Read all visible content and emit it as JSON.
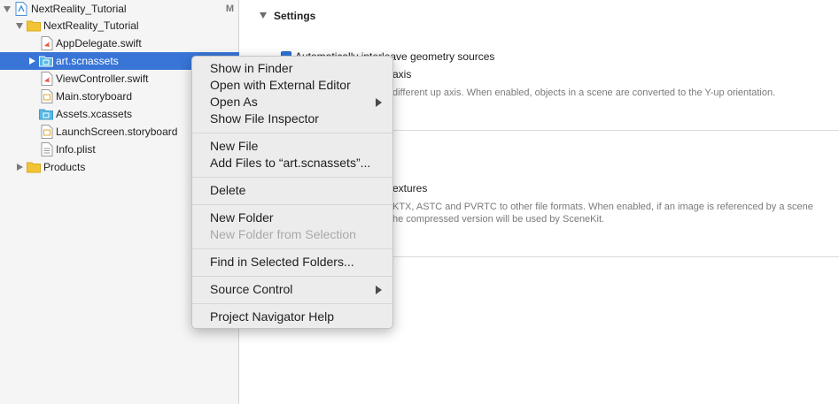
{
  "navigator": {
    "project": {
      "label": "NextReality_Tutorial",
      "badge": "M",
      "icon": "xcode-project-icon"
    },
    "items": [
      {
        "label": "NextReality_Tutorial",
        "icon": "folder-icon",
        "expanded": true
      },
      {
        "label": "AppDelegate.swift",
        "icon": "swift-file-icon"
      },
      {
        "label": "art.scnassets",
        "icon": "scnassets-folder-icon",
        "selected": true
      },
      {
        "label": "ViewController.swift",
        "icon": "swift-file-icon"
      },
      {
        "label": "Main.storyboard",
        "icon": "storyboard-file-icon"
      },
      {
        "label": "Assets.xcassets",
        "icon": "xcassets-folder-icon"
      },
      {
        "label": "LaunchScreen.storyboard",
        "icon": "storyboard-file-icon"
      },
      {
        "label": "Info.plist",
        "icon": "plist-file-icon"
      },
      {
        "label": "Products",
        "icon": "folder-icon",
        "expanded": false
      }
    ]
  },
  "settings": {
    "title": "Settings",
    "checkbox1_label": "Automatically interleave geometry sources",
    "axis_label": "axis",
    "axis_desc": "different up axis. When enabled, objects in a scene are converted to the Y-up orientation.",
    "textures_label": "extures",
    "textures_desc_1": "KTX, ASTC and PVRTC to other file formats. When enabled, if an image is referenced by a scene",
    "textures_desc_2": "he compressed version will be used by SceneKit."
  },
  "context_menu": {
    "show_in_finder": "Show in Finder",
    "open_external": "Open with External Editor",
    "open_as": "Open As",
    "show_inspector": "Show File Inspector",
    "new_file": "New File",
    "add_files": "Add Files to “art.scnassets”...",
    "delete": "Delete",
    "new_folder": "New Folder",
    "new_folder_selection": "New Folder from Selection",
    "find_in_folders": "Find in Selected Folders...",
    "source_control": "Source Control",
    "navigator_help": "Project Navigator Help"
  },
  "colors": {
    "selection": "#3875d7",
    "folder_yellow": "#f2c434",
    "asset_blue": "#55b8e6",
    "checkbox_blue": "#2f74d8"
  }
}
